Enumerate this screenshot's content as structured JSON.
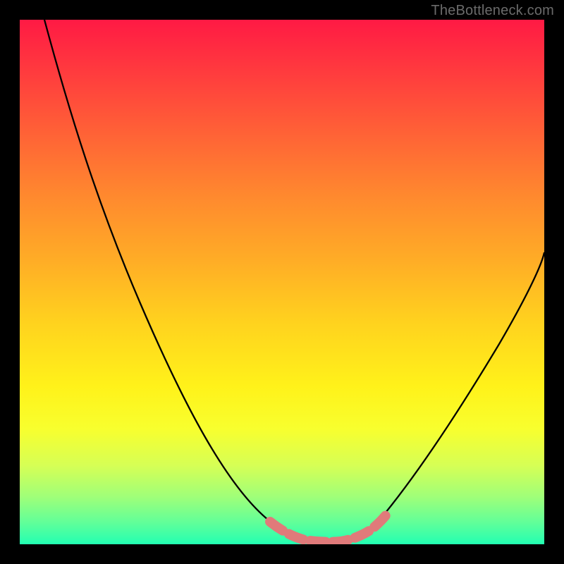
{
  "watermark": {
    "text": "TheBottleneck.com"
  },
  "colors": {
    "background": "#000000",
    "curve": "#000000",
    "highlight": "#e07a7a",
    "gradient_top": "#ff1a44",
    "gradient_bottom": "#22ffb2"
  },
  "chart_data": {
    "type": "line",
    "title": "",
    "xlabel": "",
    "ylabel": "",
    "xlim": [
      0,
      100
    ],
    "ylim": [
      0,
      100
    ],
    "grid": false,
    "legend": false,
    "annotations": [
      "TheBottleneck.com"
    ],
    "series": [
      {
        "name": "bottleneck-curve",
        "x": [
          0,
          6,
          12,
          18,
          24,
          30,
          36,
          42,
          46,
          50,
          54,
          58,
          62,
          68,
          74,
          80,
          86,
          92,
          100
        ],
        "y": [
          100,
          90,
          78,
          66,
          55,
          44,
          33,
          22,
          14,
          8,
          3,
          1,
          1,
          5,
          12,
          21,
          31,
          42,
          58
        ]
      },
      {
        "name": "optimal-range-highlight",
        "x": [
          48,
          52,
          56,
          60,
          64
        ],
        "y": [
          3.5,
          1.2,
          0.8,
          1.0,
          3.2
        ]
      }
    ]
  }
}
